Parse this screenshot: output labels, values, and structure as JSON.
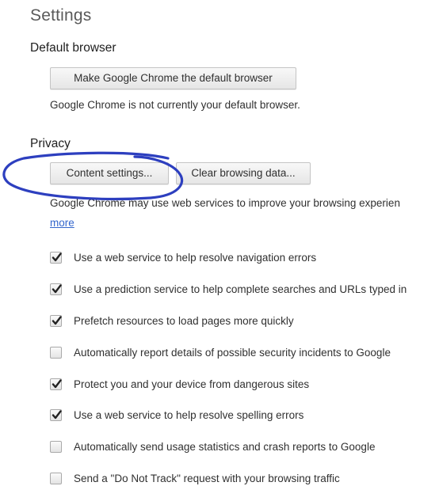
{
  "title": "Settings",
  "default_browser": {
    "heading": "Default browser",
    "button_label": "Make Google Chrome the default browser",
    "status_text": "Google Chrome is not currently your default browser."
  },
  "privacy": {
    "heading": "Privacy",
    "content_settings_label": "Content settings...",
    "clear_browsing_data_label": "Clear browsing data...",
    "description": "Google Chrome may use web services to improve your browsing experien",
    "learn_more_label": "more",
    "options": [
      {
        "label": "Use a web service to help resolve navigation errors",
        "checked": true
      },
      {
        "label": "Use a prediction service to help complete searches and URLs typed in",
        "checked": true
      },
      {
        "label": "Prefetch resources to load pages more quickly",
        "checked": true
      },
      {
        "label": "Automatically report details of possible security incidents to Google",
        "checked": false
      },
      {
        "label": "Protect you and your device from dangerous sites",
        "checked": true
      },
      {
        "label": "Use a web service to help resolve spelling errors",
        "checked": true
      },
      {
        "label": "Automatically send usage statistics and crash reports to Google",
        "checked": false
      },
      {
        "label": "Send a \"Do Not Track\" request with your browsing traffic",
        "checked": false
      }
    ]
  },
  "annotation_color": "#2d3fbf"
}
